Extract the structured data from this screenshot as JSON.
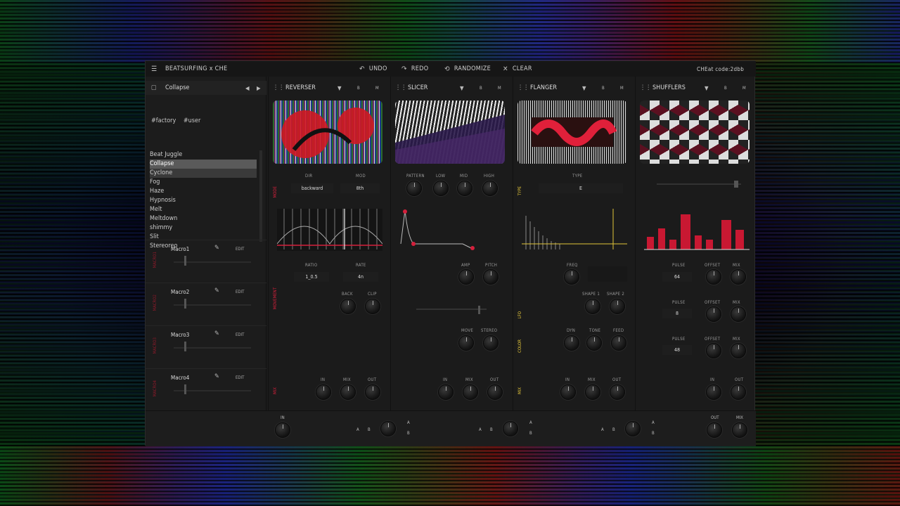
{
  "titlebar": {
    "app_title": "BEATSURFING x CHE",
    "undo": "UNDO",
    "redo": "REDO",
    "randomize": "RANDOMIZE",
    "clear": "CLEAR",
    "code": "CHEat code:2dbb"
  },
  "left": {
    "preset_name": "Collapse",
    "tags": [
      "#factory",
      "#user"
    ],
    "presets": [
      "Beat Juggle",
      "Collapse",
      "Cyclone",
      "Fog",
      "Haze",
      "Hypnosis",
      "Melt",
      "Meltdown",
      "shimmy",
      "Slit",
      "Stereoreo"
    ],
    "macros": [
      {
        "label": "Macro1",
        "edit": "EDIT"
      },
      {
        "label": "Macro2",
        "edit": "EDIT"
      },
      {
        "label": "Macro3",
        "edit": "EDIT"
      },
      {
        "label": "Macro4",
        "edit": "EDIT"
      }
    ]
  },
  "modules": {
    "reverser": {
      "name": "REVERSER",
      "b": "B",
      "m": "M",
      "dir_label": "DIR",
      "dir_value": "backward",
      "mod_label": "MOD",
      "mod_value": "8th",
      "ratio_label": "RATIO",
      "ratio_value": "1_0.5",
      "rate_label": "RATE",
      "rate_value": "4n",
      "back": "BACK",
      "clip": "CLIP",
      "in": "IN",
      "mix": "MIX",
      "out": "OUT"
    },
    "slicer": {
      "name": "SLICER",
      "b": "B",
      "m": "M",
      "pattern": "PATTERN",
      "low": "LOW",
      "mid": "MID",
      "high": "HIGH",
      "amp": "AMP",
      "pitch": "PITCH",
      "move": "MOVE",
      "stereo": "STEREO",
      "in": "IN",
      "mix": "MIX",
      "out": "OUT"
    },
    "flanger": {
      "name": "FLANGER",
      "b": "B",
      "m": "M",
      "type_label": "TYPE",
      "type_value": "E",
      "freq": "FREQ",
      "shape1": "SHAPE 1",
      "shape2": "SHAPE 2",
      "dyn": "DYN",
      "tone": "TONE",
      "feed": "FEED",
      "in": "IN",
      "mix": "MIX",
      "out": "OUT"
    },
    "shufflers": {
      "name": "SHUFFLERS",
      "b": "B",
      "m": "M",
      "pulse": "PULSE",
      "offset": "OFFSET",
      "mix": "MIX",
      "pulse1": "64",
      "pulse2": "8",
      "pulse3": "48",
      "in": "IN",
      "out": "OUT"
    }
  },
  "vertical_labels": {
    "mode": "MODE",
    "movement": "MOVEMENT",
    "mix": "MIX",
    "type": "TYPE",
    "lfo": "LFO",
    "color": "COLOR"
  },
  "bottom": {
    "in": "IN",
    "out": "OUT",
    "mix": "MIX",
    "a": "A",
    "b": "B"
  },
  "colors": {
    "accent_red": "#d4203c",
    "accent_yellow": "#e2c43a",
    "bg": "#1b1b1b"
  }
}
